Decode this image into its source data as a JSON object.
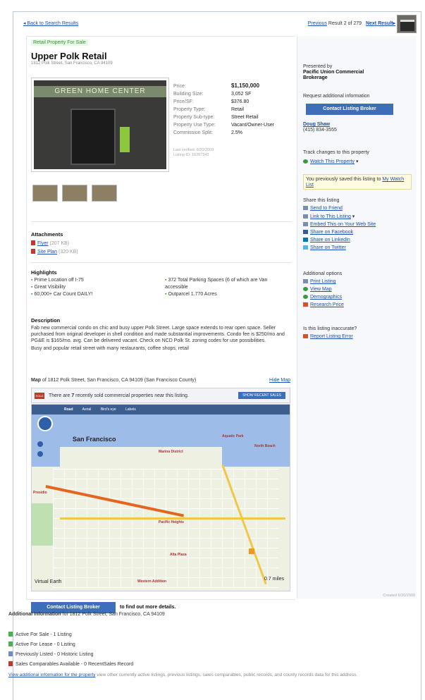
{
  "nav": {
    "back": "Back to Search Results",
    "previous": "Previous",
    "result_text": "Result 2 of 279",
    "next": "Next Result"
  },
  "listing": {
    "tag": "Retail Property For Sale",
    "title": "Upper Polk Retail",
    "address": "1812 Polk Street, San Francisco, CA 94109",
    "photo_sign": "GREEN HOME CENTER",
    "specs": [
      {
        "label": "Price:",
        "value": "$1,150,000"
      },
      {
        "label": "Building Size:",
        "value": "3,052 SF"
      },
      {
        "label": "Price/SF:",
        "value": "$376.80"
      },
      {
        "label": "Property Type:",
        "value": "Retail"
      },
      {
        "label": "Property Sub-type:",
        "value": "Street Retail"
      },
      {
        "label": "Property Use Type:",
        "value": "Vacant/Owner-User"
      },
      {
        "label": "Commission Split:",
        "value": "2.5%"
      }
    ],
    "meta1": "Last verified: 6/20/2009",
    "meta2": "Listing ID: 16287343"
  },
  "attachments": {
    "heading": "Attachments",
    "items": [
      {
        "name": "Flyer",
        "size": "(207 KB)"
      },
      {
        "name": "Site Plan",
        "size": "(320 KB)"
      }
    ]
  },
  "highlights": {
    "heading": "Highlights",
    "col1": [
      "Prime Location off I-75",
      "Great Visibility",
      "60,000+ Car Count DAILY!"
    ],
    "col2": [
      "372 Total Parking Spaces (6 of which are Van accessible",
      "Outparcel 1.770 Acres"
    ]
  },
  "description": {
    "heading": "Description",
    "p1": "Fab new commercial condo on chic and busy upper Polk Street. Large space extends to rear open space. Seller purchased from original developer in shell condition and made substantial improvements. Condo fee is $250/mo and PG&E is $165/mo. avg. Can be delivered vacant. Check on NCD Polk St. zoning codes for use possibilities.",
    "p2": "Busy and popular retail street with many restaurants, coffee shops, retail"
  },
  "map": {
    "label": "Map",
    "of_text": "of 1812 Polk Street, San Francisco, CA 94109 (San Francisco County)",
    "hide": "Hide Map",
    "sold_badge": "SOLD",
    "sold_text_pre": "There are",
    "sold_count": "7",
    "sold_text_post": "recently sold commercial properties near this listing.",
    "show_btn": "SHOW RECENT SALES",
    "tabs": [
      "Road",
      "Aerial",
      "Bird's eye",
      "Labels"
    ],
    "city": "San Francisco",
    "brand": "Virtual Earth",
    "scale": "0.7 miles",
    "places": [
      "Marina District",
      "Pacific Heights",
      "Presidio",
      "Aquatic Park",
      "North Beach",
      "Alta Plaza",
      "Western Addition"
    ]
  },
  "cta": {
    "button": "Contact Listing Broker",
    "text": "to find out more details."
  },
  "sidebar": {
    "presented_by": "Presented by",
    "company": "Pacific Union Commercial Brokerage",
    "request": "Request additional information",
    "contact_btn": "Contact Listing Broker",
    "broker_name": "Doug Shaw",
    "broker_phone": "(415) 834-3555",
    "track": "Track changes to this property",
    "watch": "Watch This Property",
    "saved_pre": "You previously saved this listing to",
    "saved_link": "My Watch List",
    "share_heading": "Share this listing",
    "share": [
      "Send to Friend",
      "Link to This Listing",
      "Embed This on Your Web Site",
      "Share on Facebook",
      "Share on LinkedIn",
      "Share on Twitter"
    ],
    "options_heading": "Additional options",
    "options": [
      "Print Listing",
      "View Map",
      "Demographics",
      "Research Price"
    ],
    "inaccurate": "Is this listing inaccurate?",
    "report": "Report Listing Error"
  },
  "footer": {
    "created": "Created 6/20/2009",
    "addl_heading": "Additional Information",
    "addl_for": "for 1812 Polk Street, San Francisco, CA 94109",
    "counts": [
      {
        "text": "Active For Sale - 1 Listing",
        "color": "#4caf50"
      },
      {
        "text": "Active For Lease - 0 Listing",
        "color": "#4caf50"
      },
      {
        "text": "Previously Listed - 0 Historic Listing",
        "color": "#6a8fc8"
      },
      {
        "text": "Sales Comparables Available - 0 RecentSales Record",
        "color": "#c0392b"
      }
    ],
    "view_link": "View additional information for the property",
    "view_rest": "view other currently active listings, previous listings, sales comparables, public records, and county records data for this address."
  }
}
